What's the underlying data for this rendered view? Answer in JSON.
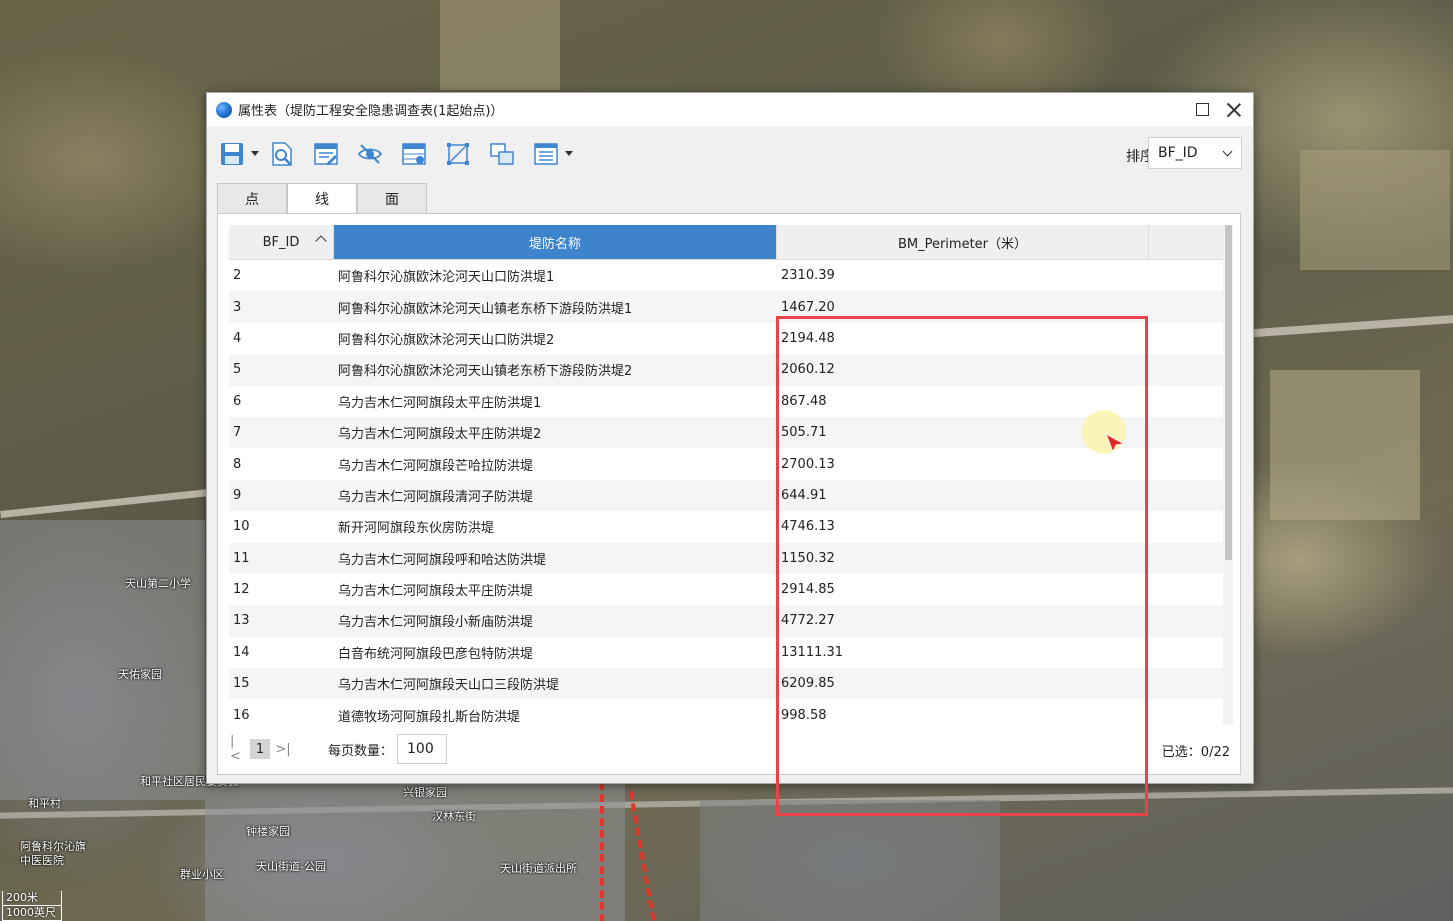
{
  "window": {
    "title": "属性表（堤防工程安全隐患调查表(1起始点)）"
  },
  "toolbar": {
    "sort_label": "排序",
    "sort_value": "BF_ID",
    "icons": [
      "save-icon",
      "preview-icon",
      "edit-icon",
      "hide-icon",
      "table-settings-icon",
      "select-extent-icon",
      "link-icon",
      "list-options-icon"
    ]
  },
  "tabs": [
    {
      "label": "点"
    },
    {
      "label": "线"
    },
    {
      "label": "面"
    }
  ],
  "table": {
    "headers": [
      "BF_ID",
      "堤防名称",
      "BM_Perimeter（米）"
    ],
    "rows": [
      {
        "id": "2",
        "name": "阿鲁科尔沁旗欧沐沦河天山口防洪堤1",
        "perimeter": "2310.39"
      },
      {
        "id": "3",
        "name": "阿鲁科尔沁旗欧沐沦河天山镇老东桥下游段防洪堤1",
        "perimeter": "1467.20"
      },
      {
        "id": "4",
        "name": "阿鲁科尔沁旗欧沐沦河天山口防洪堤2",
        "perimeter": "2194.48"
      },
      {
        "id": "5",
        "name": "阿鲁科尔沁旗欧沐沦河天山镇老东桥下游段防洪堤2",
        "perimeter": "2060.12"
      },
      {
        "id": "6",
        "name": "乌力吉木仁河阿旗段太平庄防洪堤1",
        "perimeter": "867.48"
      },
      {
        "id": "7",
        "name": "乌力吉木仁河阿旗段太平庄防洪堤2",
        "perimeter": "505.71"
      },
      {
        "id": "8",
        "name": "乌力吉木仁河阿旗段芒哈拉防洪堤",
        "perimeter": "2700.13"
      },
      {
        "id": "9",
        "name": "乌力吉木仁河阿旗段清河子防洪堤",
        "perimeter": "644.91"
      },
      {
        "id": "10",
        "name": "新开河阿旗段东伙房防洪堤",
        "perimeter": "4746.13"
      },
      {
        "id": "11",
        "name": "乌力吉木仁河阿旗段呼和哈达防洪堤",
        "perimeter": "1150.32"
      },
      {
        "id": "12",
        "name": "乌力吉木仁河阿旗段太平庄防洪堤",
        "perimeter": "2914.85"
      },
      {
        "id": "13",
        "name": "乌力吉木仁河阿旗段小新庙防洪堤",
        "perimeter": "4772.27"
      },
      {
        "id": "14",
        "name": "白音布统河阿旗段巴彦包特防洪堤",
        "perimeter": "13111.31"
      },
      {
        "id": "15",
        "name": "乌力吉木仁河阿旗段天山口三段防洪堤",
        "perimeter": "6209.85"
      },
      {
        "id": "16",
        "name": "道德牧场河阿旗段扎斯台防洪堤",
        "perimeter": "998.58"
      }
    ]
  },
  "pager": {
    "current_page": "1",
    "per_page_label": "每页数量：",
    "per_page_value": "100",
    "selected_text": "已选：0/22"
  },
  "map": {
    "labels": [
      "天山第二小学",
      "天佑家园",
      "和平社区居民委员会",
      "和平村",
      "阿鲁科尔沁旗中医医院",
      "钟楼家园",
      "汉林东街",
      "兴银家园",
      "天山街道-公园",
      "天山街道派出所",
      "群业小区"
    ],
    "scale_top": "200米",
    "scale_bottom": "1000英尺"
  },
  "colors": {
    "header_selected": "#3d84cc",
    "highlight_border": "#e8434a"
  }
}
